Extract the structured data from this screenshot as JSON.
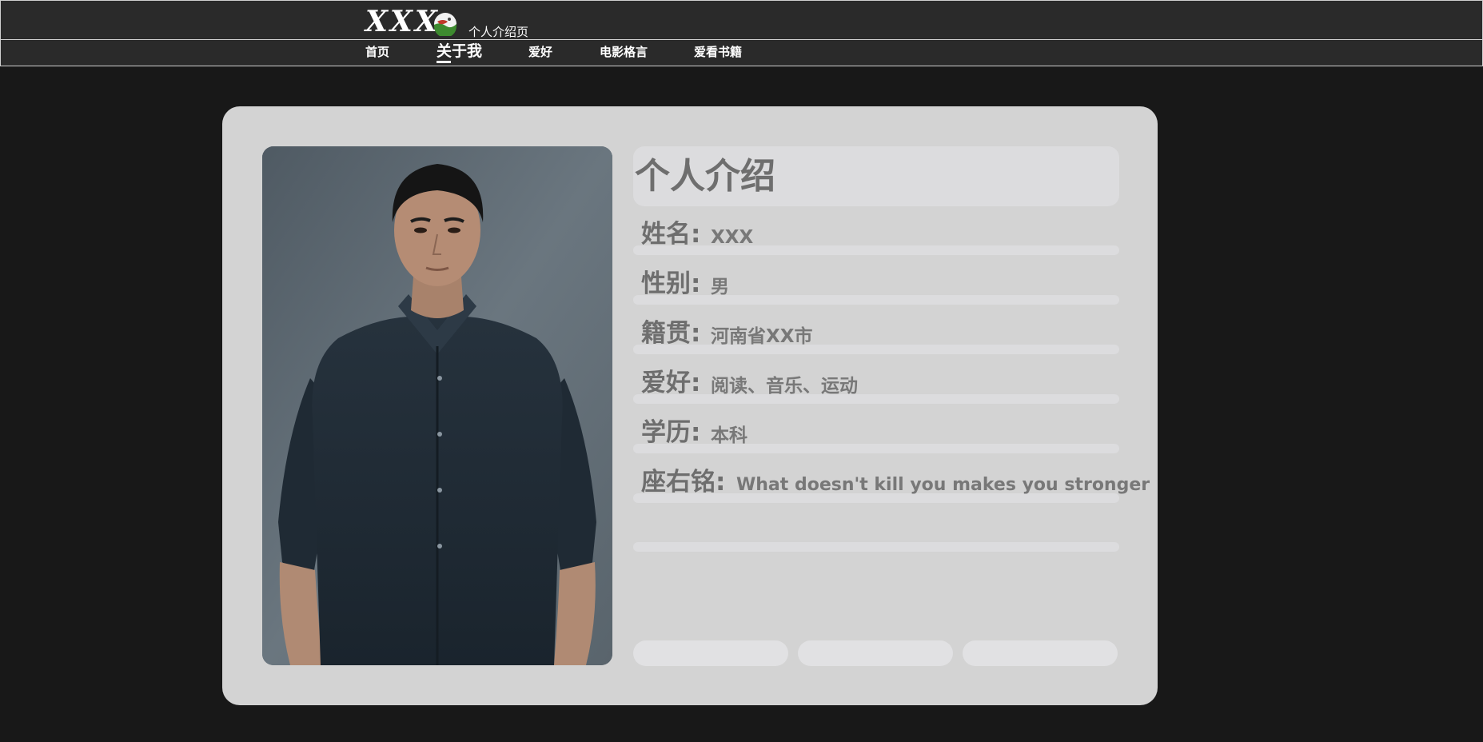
{
  "header": {
    "logo_text": "XXX",
    "subtitle": "个人介绍页"
  },
  "nav": {
    "items": [
      {
        "label": "首页"
      },
      {
        "label": "关于我"
      },
      {
        "label": "爱好"
      },
      {
        "label": "电影格言"
      },
      {
        "label": "爱看书籍"
      }
    ],
    "active_index": 1
  },
  "profile": {
    "title": "个人介绍",
    "fields": [
      {
        "label": "姓名:",
        "value": "XXX"
      },
      {
        "label": "性别:",
        "value": "男"
      },
      {
        "label": "籍贯:",
        "value": "河南省XX市"
      },
      {
        "label": "爱好:",
        "value": "阅读、音乐、运动"
      },
      {
        "label": "学历:",
        "value": "本科"
      },
      {
        "label": "座右铭:",
        "value": "What doesn't kill you makes you stronger"
      }
    ],
    "buttons": [
      {
        "label": ""
      },
      {
        "label": ""
      },
      {
        "label": ""
      }
    ]
  },
  "colors": {
    "page_bg": "#181818",
    "header_bg": "#2a2a2a",
    "card_bg": "#d3d3d3",
    "accent_box": "#dcdcde",
    "text_gray": "#6e6e6e"
  }
}
